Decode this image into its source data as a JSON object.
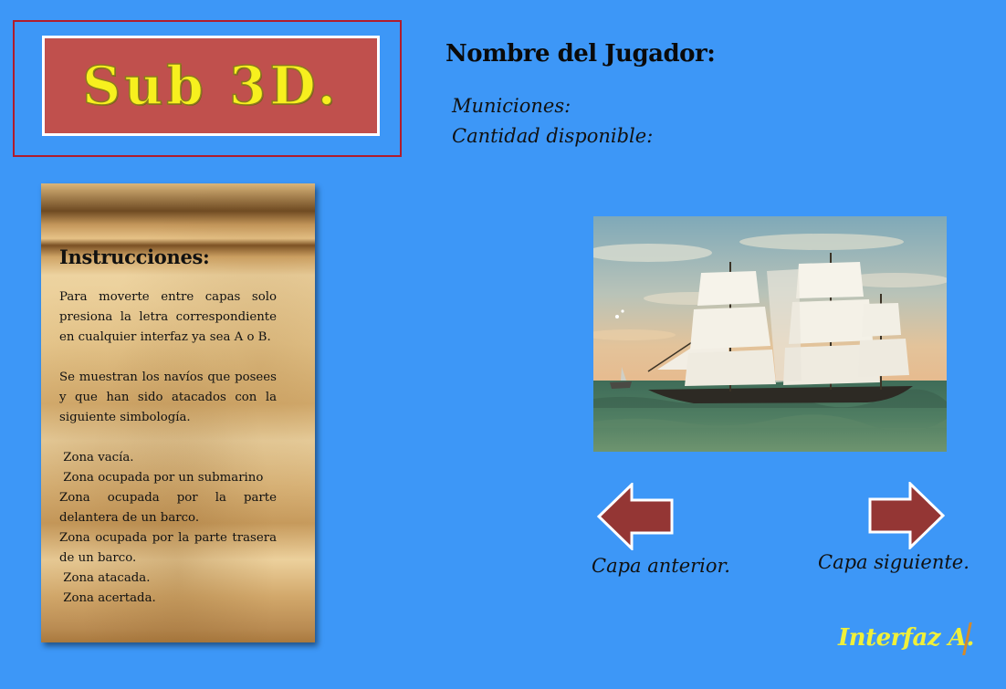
{
  "logo": {
    "text": "Sub 3D."
  },
  "player": {
    "name_label": "Nombre del Jugador:",
    "ammo_label": "Municiones:",
    "available_label": "Cantidad disponible:"
  },
  "instructions": {
    "title": "Instrucciones:",
    "paragraph1": "Para moverte entre capas solo presiona la letra correspondiente en cualquier interfaz ya sea A o B.",
    "paragraph2": "Se muestran los navíos que posees y que han sido atacados con la siguiente simbología.",
    "legend": [
      " Zona vacía.",
      " Zona ocupada por un submarino",
      " Zona ocupada por la parte delantera de un barco.",
      " Zona ocupada por la parte trasera de un barco.",
      " Zona atacada.",
      " Zona acertada."
    ]
  },
  "navigation": {
    "prev_label": "Capa anterior.",
    "next_label": "Capa siguiente."
  },
  "interface_label": "Interfaz A.",
  "colors": {
    "background": "#3d97f7",
    "logo_box": "#c0504d",
    "logo_text": "#f7f01e",
    "logo_frame": "#b01c2c",
    "arrow_fill": "#943634",
    "interface_text": "#f0f03a"
  }
}
